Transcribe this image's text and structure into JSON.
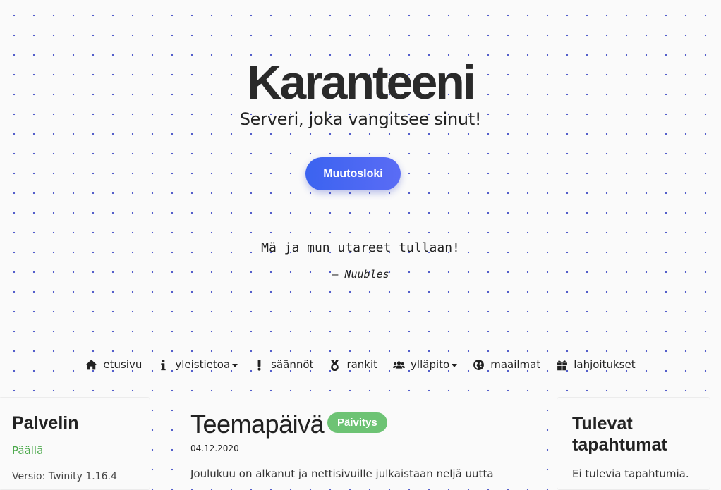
{
  "hero": {
    "title": "Karanteeni",
    "subtitle": "Serveri, joka vangitsee sinut!",
    "changelog_button": "Muutosloki",
    "quote": "Mä ja mun utareet tullaan!",
    "quote_dash": "– ",
    "quote_author": "Nuubles"
  },
  "nav": {
    "items": [
      {
        "label": "etusivu",
        "icon": "home-icon"
      },
      {
        "label": "yleistietoa",
        "icon": "info-icon",
        "dropdown": true
      },
      {
        "label": "säännöt",
        "icon": "exclamation-icon"
      },
      {
        "label": "rankit",
        "icon": "medal-icon"
      },
      {
        "label": "ylläpito",
        "icon": "users-icon",
        "dropdown": true
      },
      {
        "label": "maailmat",
        "icon": "globe-icon"
      },
      {
        "label": "lahjoitukset",
        "icon": "gift-icon"
      }
    ]
  },
  "server_card": {
    "title": "Palvelin",
    "status": "Päällä",
    "version": "Versio: Twinity 1.16.4"
  },
  "post": {
    "title": "Teemapäivä",
    "badge": "Päivitys",
    "date": "04.12.2020",
    "excerpt": "Joulukuu on alkanut ja nettisivuille julkaistaan neljä uutta"
  },
  "events_card": {
    "title_line1": "Tulevat",
    "title_line2": "tapahtumat",
    "empty": "Ei tulevia tapahtumia."
  },
  "colors": {
    "accent": "#3b63f0",
    "status_on": "#4aa84a",
    "badge": "#6dc374",
    "dots": "#4a55c8"
  }
}
